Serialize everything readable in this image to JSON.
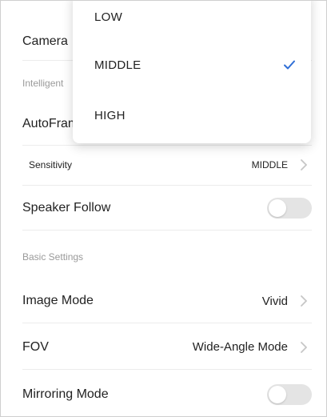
{
  "settings": {
    "camera_label": "Camera",
    "intelligent_header": "Intelligent",
    "autoframing_label": "AutoFraming",
    "sensitivity_label": "Sensitivity",
    "sensitivity_value": "MIDDLE",
    "speaker_follow_label": "Speaker Follow",
    "speaker_follow_on": false,
    "basic_header": "Basic Settings",
    "image_mode_label": "Image Mode",
    "image_mode_value": "Vivid",
    "fov_label": "FOV",
    "fov_value": "Wide-Angle Mode",
    "mirroring_label": "Mirroring Mode",
    "mirroring_on": false
  },
  "dropdown": {
    "options": [
      "LOW",
      "MIDDLE",
      "HIGH"
    ],
    "selected": "MIDDLE"
  },
  "colors": {
    "accent": "#2f6fd6",
    "toggle_off": "#e4e4e4",
    "divider": "#ececec",
    "header_text": "#9a9a9a"
  },
  "icons": {
    "chevron": "chevron-right-icon",
    "check": "checkmark-icon"
  }
}
